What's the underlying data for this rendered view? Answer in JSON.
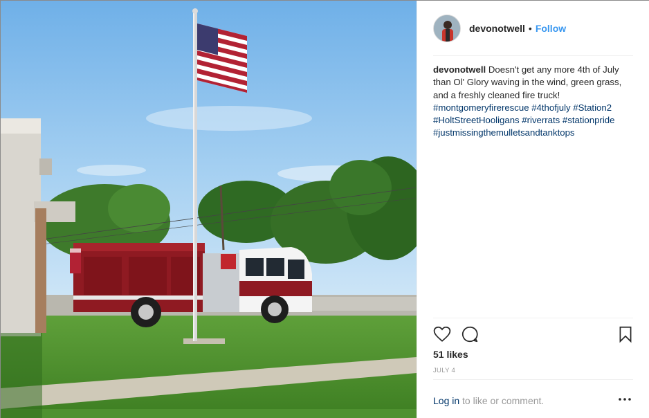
{
  "post": {
    "username": "devonotwell",
    "separator": "•",
    "follow_label": "Follow",
    "caption_user": "devonotwell",
    "caption_text": "Doesn't get any more 4th of July than Ol' Glory waving in the wind, green grass, and a freshly cleaned fire truck!",
    "hashtags": "#montgomeryfirerescue #4thofjuly #Station2 #HoltStreetHooligans #riverrats #stationpride #justmissingthemulletsandtanktops",
    "likes": "51 likes",
    "date": "JULY 4",
    "login_link": "Log in",
    "login_rest": " to like or comment.",
    "more_glyph": "•••"
  },
  "icons": {
    "like": "heart-icon",
    "comment": "comment-icon",
    "save": "bookmark-icon",
    "more": "more-options-icon"
  },
  "colors": {
    "follow": "#3897f0",
    "hashtag": "#003569",
    "muted": "#999999",
    "text": "#262626",
    "truck_red": "#8f1a22",
    "sky": "#8fc1ec",
    "grass": "#4b8f2a"
  }
}
